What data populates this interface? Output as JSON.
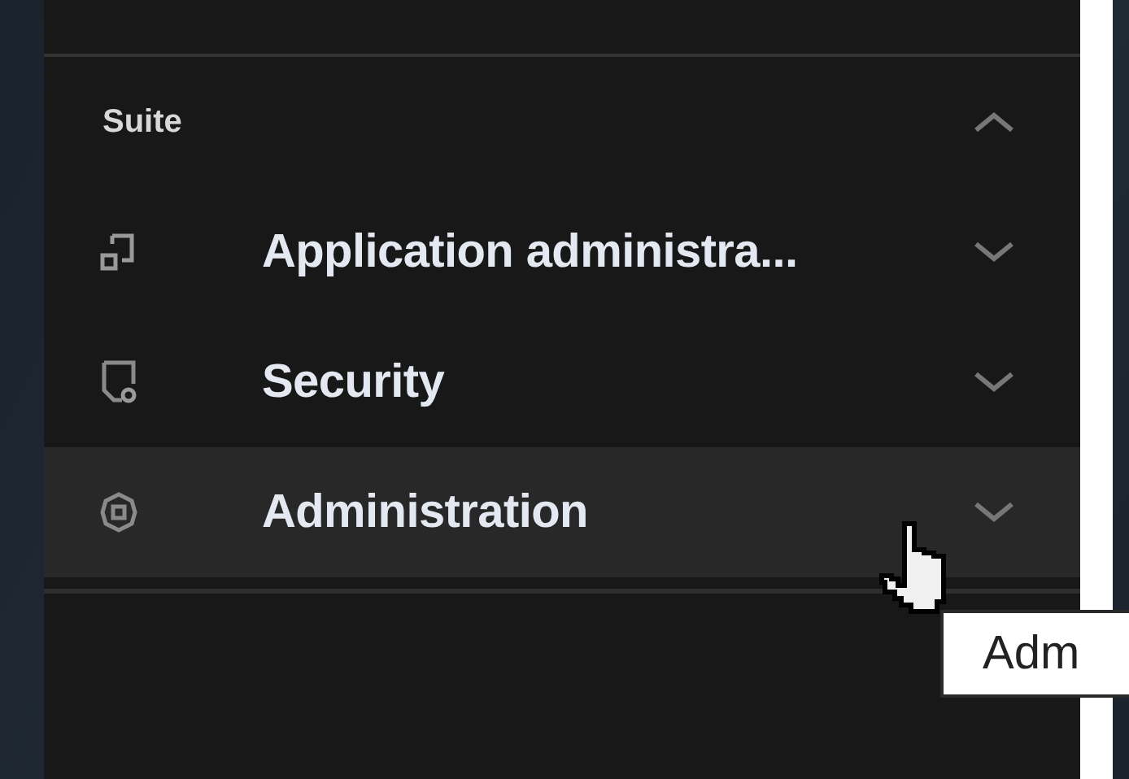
{
  "section": {
    "title": "Suite",
    "expanded": true
  },
  "items": [
    {
      "kind": "app",
      "label": "Application administra...",
      "expanded": false,
      "hovered": false
    },
    {
      "kind": "security",
      "label": "Security",
      "expanded": false,
      "hovered": false
    },
    {
      "kind": "settings",
      "label": "Administration",
      "expanded": false,
      "hovered": true
    }
  ],
  "tooltip": {
    "text": "Adm"
  }
}
